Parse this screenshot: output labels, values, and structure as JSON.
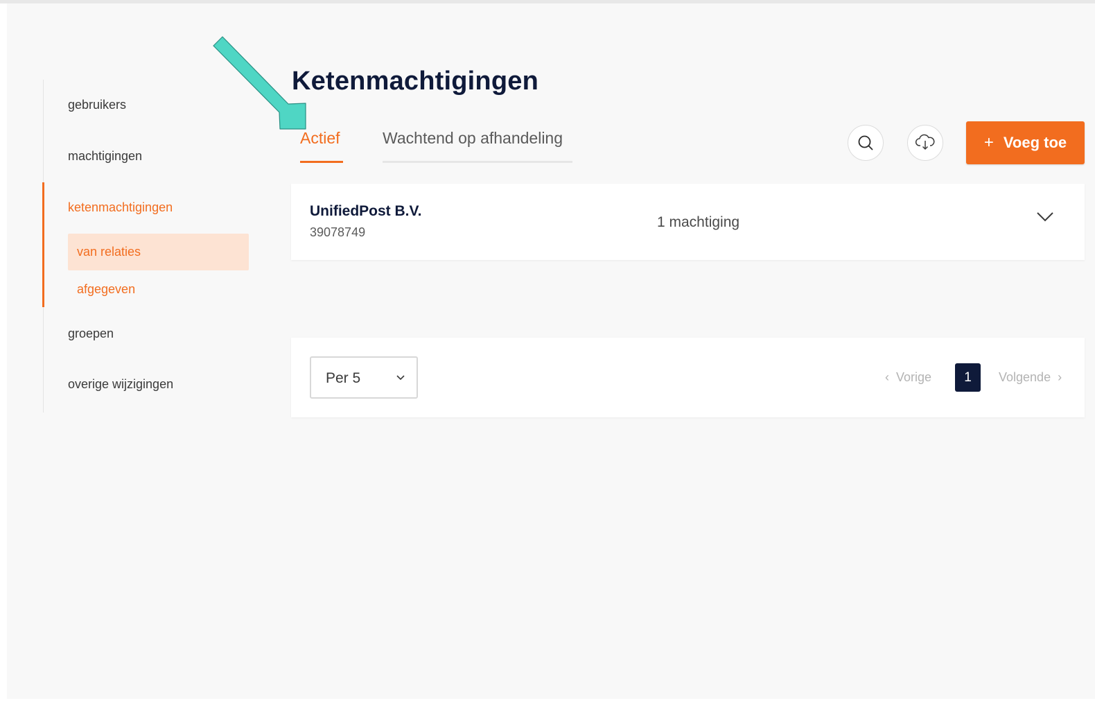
{
  "page": {
    "title": "Ketenmachtigingen"
  },
  "sidebar": {
    "items": [
      {
        "label": "gebruikers"
      },
      {
        "label": "machtigingen"
      },
      {
        "label": "ketenmachtigingen"
      },
      {
        "label": "groepen"
      },
      {
        "label": "overige wijzigingen"
      }
    ],
    "subitems": [
      {
        "label": "van relaties",
        "selected": true
      },
      {
        "label": "afgegeven",
        "selected": false
      }
    ]
  },
  "tabs": [
    {
      "label": "Actief",
      "active": true
    },
    {
      "label": "Wachtend op afhandeling",
      "active": false
    }
  ],
  "toolbar": {
    "search_icon": "search-icon",
    "download_icon": "cloud-download-icon",
    "add_button": {
      "icon": "+",
      "label": "Voeg toe"
    }
  },
  "list": {
    "items": [
      {
        "name": "UnifiedPost B.V.",
        "id": "39078749",
        "count": "1 machtiging"
      }
    ]
  },
  "pagination": {
    "per_page": "Per 5",
    "prev": "Vorige",
    "current": "1",
    "next": "Volgende"
  },
  "colors": {
    "accent": "#f26d1f",
    "navy": "#0f1a3a",
    "annotation": "#4fd6c4"
  }
}
